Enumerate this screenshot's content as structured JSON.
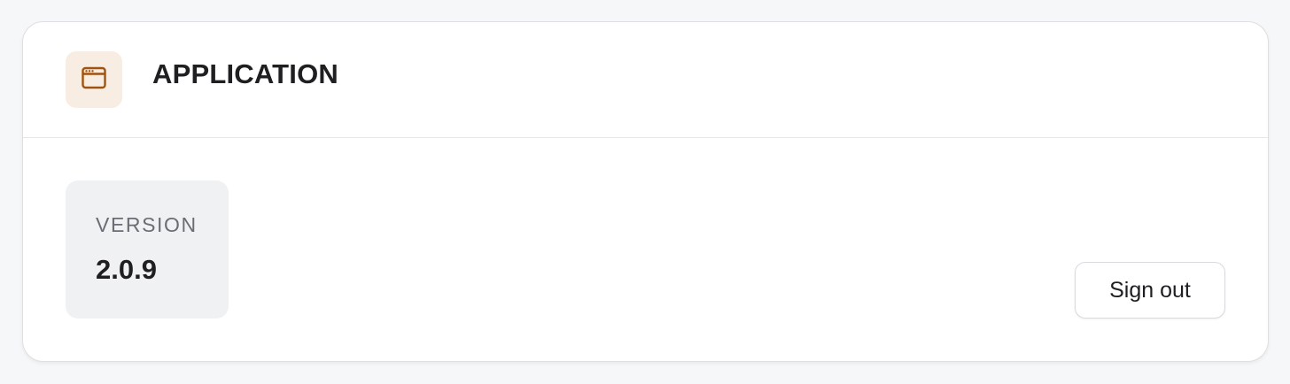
{
  "section": {
    "title": "APPLICATION",
    "icon": "browser-window-icon",
    "icon_color": "#a0520f",
    "icon_background": "#f8ede3"
  },
  "version": {
    "label": "VERSION",
    "value": "2.0.9"
  },
  "actions": {
    "sign_out_label": "Sign out"
  }
}
